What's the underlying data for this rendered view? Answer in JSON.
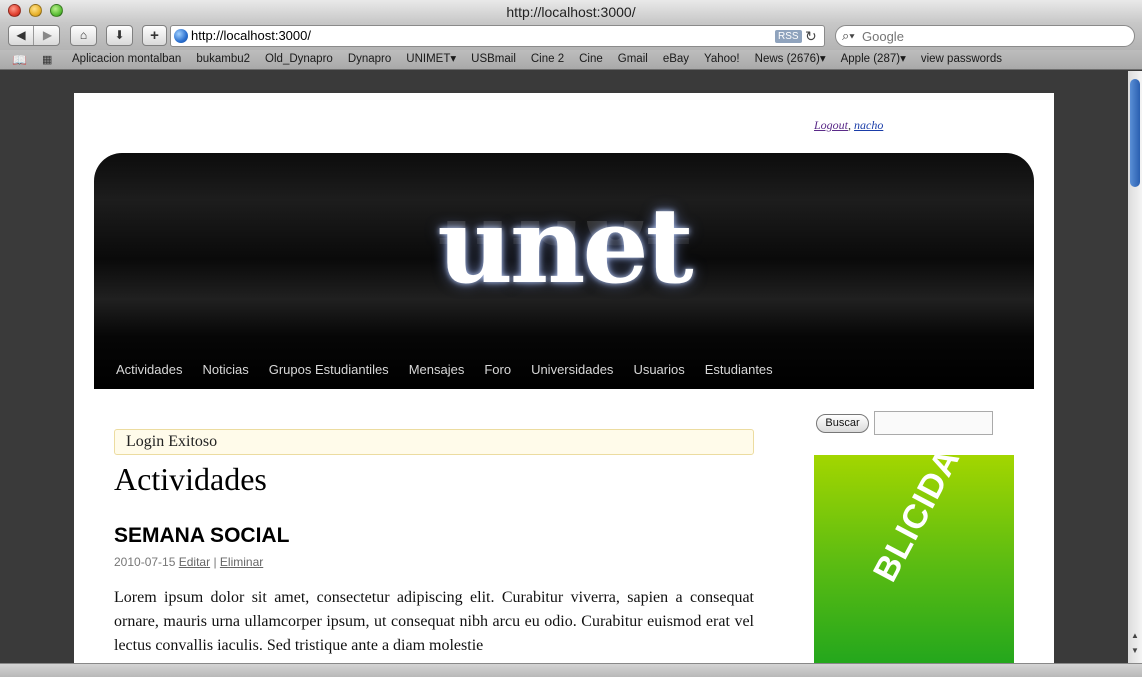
{
  "window": {
    "title": "http://localhost:3000/"
  },
  "toolbar": {
    "back_glyph": "◀",
    "forward_glyph": "▶",
    "home_glyph": "⌂",
    "download_glyph": "⬇",
    "add_glyph": "+",
    "url": "http://localhost:3000/",
    "rss_label": "RSS",
    "reload_glyph": "↻",
    "search_placeholder": "Google"
  },
  "bookmarks": {
    "items": [
      "Aplicacion montalban",
      "bukambu2",
      "Old_Dynapro",
      "Dynapro",
      "UNIMET▾",
      "USBmail",
      "Cine 2",
      "Cine",
      "Gmail",
      "eBay",
      "Yahoo!",
      "News (2676)▾",
      "Apple (287)▾",
      "view passwords"
    ]
  },
  "page": {
    "user": {
      "logout": "Logout",
      "separator": ",",
      "username": "nacho"
    },
    "logo": "unet",
    "nav": [
      "Actividades",
      "Noticias",
      "Grupos Estudiantiles",
      "Mensajes",
      "Foro",
      "Universidades",
      "Usuarios",
      "Estudiantes"
    ],
    "flash": "Login Exitoso",
    "heading": "Actividades",
    "post": {
      "title": "SEMANA SOCIAL",
      "date": "2010-07-15",
      "edit": "Editar",
      "sep": "|",
      "delete": "Eliminar",
      "body": "Lorem ipsum dolor sit amet, consectetur adipiscing elit. Curabitur viverra, sapien a consequat ornare, mauris urna ullamcorper ipsum, ut consequat nibh arcu eu odio. Curabitur euismod erat vel lectus convallis iaculis. Sed tristique ante a diam molestie"
    },
    "sidebar": {
      "search_button": "Buscar",
      "ad_text": "BLICIDAD"
    }
  },
  "colors": {
    "ad_green": "#5cbc12",
    "header_black": "#0a0a0a"
  }
}
